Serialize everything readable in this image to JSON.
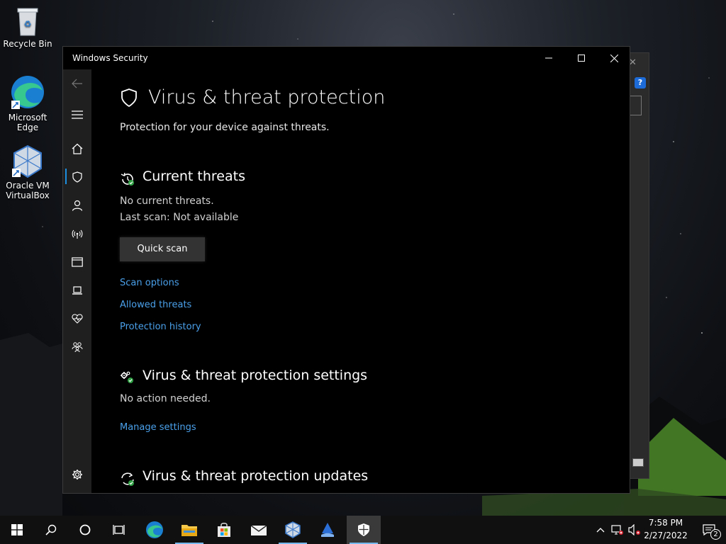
{
  "desktop": {
    "icons": [
      {
        "label": "Recycle Bin"
      },
      {
        "label": "Microsoft Edge"
      },
      {
        "label": "Oracle VM VirtualBox"
      }
    ]
  },
  "window": {
    "title": "Windows Security",
    "page_title": "Virus & threat protection",
    "subtitle": "Protection for your device against threats.",
    "current_threats": {
      "title": "Current threats",
      "status": "No current threats.",
      "last_scan": "Last scan: Not available",
      "button": "Quick scan",
      "links": [
        "Scan options",
        "Allowed threats",
        "Protection history"
      ]
    },
    "settings": {
      "title": "Virus & threat protection settings",
      "status": "No action needed.",
      "link": "Manage settings"
    },
    "updates": {
      "title": "Virus & threat protection updates"
    }
  },
  "taskbar": {
    "time": "7:58 PM",
    "date": "2/27/2022",
    "notification_count": "2"
  },
  "colors": {
    "link": "#4aa0ea",
    "accent": "#1d8fe0",
    "sidebar": "#1f1f1f"
  }
}
